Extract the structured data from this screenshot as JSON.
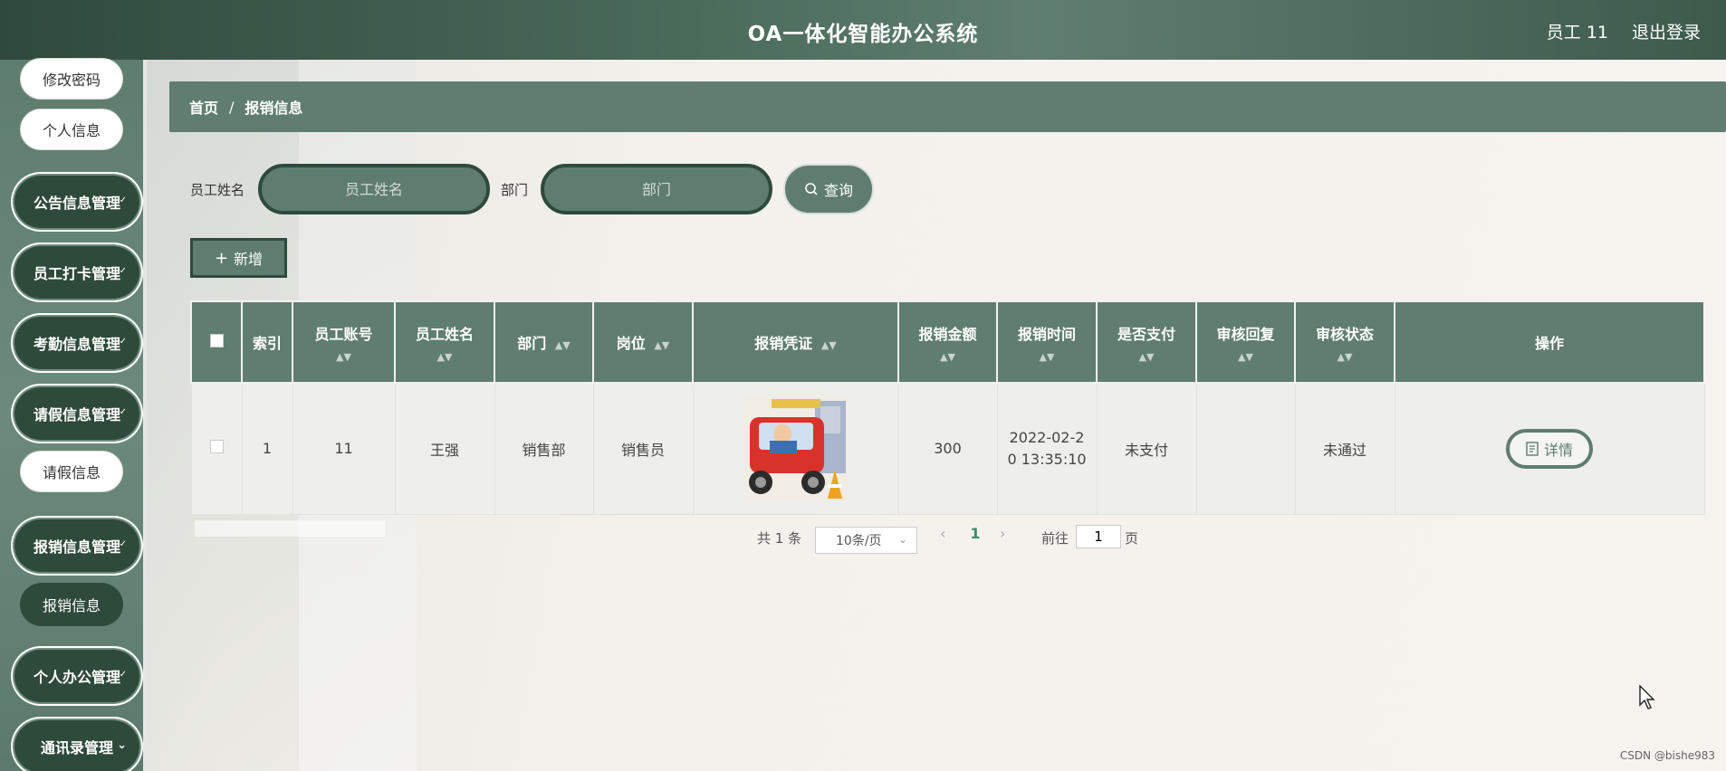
{
  "header": {
    "title": "OA一体化智能办公系统",
    "user": "员工 11",
    "logout": "退出登录"
  },
  "sidebar": {
    "change_password": "修改密码",
    "profile": "个人信息",
    "menus": [
      {
        "label": "公告信息管理"
      },
      {
        "label": "员工打卡管理"
      },
      {
        "label": "考勤信息管理"
      },
      {
        "label": "请假信息管理"
      },
      {
        "label": "请假信息"
      },
      {
        "label": "报销信息管理"
      },
      {
        "label": "报销信息"
      },
      {
        "label": "个人办公管理"
      },
      {
        "label": "通讯录管理"
      }
    ]
  },
  "breadcrumb": {
    "home": "首页",
    "separator": "/",
    "current": "报销信息"
  },
  "search": {
    "name_label": "员工姓名",
    "name_placeholder": "员工姓名",
    "dept_label": "部门",
    "dept_placeholder": "部门",
    "query_label": "查询"
  },
  "add_label": "新增",
  "table": {
    "headers": [
      "索引",
      "员工账号",
      "员工姓名",
      "部门",
      "岗位",
      "报销凭证",
      "报销金额",
      "报销时间",
      "是否支付",
      "审核回复",
      "审核状态",
      "操作"
    ],
    "rows": [
      {
        "index": "1",
        "account": "11",
        "name": "王强",
        "department": "销售部",
        "position": "销售员",
        "voucher": "taxi-receipt-image",
        "amount": "300",
        "time_line1": "2022-02-2",
        "time_line2": "0 13:35:10",
        "paid": "未支付",
        "reply": "",
        "status": "未通过",
        "action": "详情"
      }
    ]
  },
  "pagination": {
    "total": "共 1 条",
    "page_size": "10条/页",
    "current_page": "1",
    "goto_label": "前往",
    "goto_value": "1",
    "page_unit": "页"
  },
  "watermark": "CSDN @bishe983",
  "colors": {
    "primary": "#5e7d6e",
    "dark": "#2e4a3a",
    "header": "#3d5a4b"
  }
}
